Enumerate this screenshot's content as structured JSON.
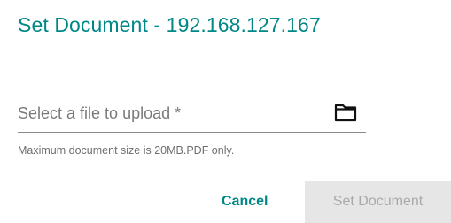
{
  "dialog": {
    "title": "Set Document - 192.168.127.167",
    "file_field": {
      "placeholder": "Select a file to upload *",
      "icon": "folder-icon"
    },
    "hint": "Maximum document size is 20MB.PDF only.",
    "actions": {
      "cancel_label": "Cancel",
      "submit_label": "Set Document",
      "submit_disabled": true
    }
  },
  "colors": {
    "accent": "#008787",
    "disabled_bg": "#e6e6e6",
    "disabled_text": "#a9a9a9",
    "placeholder_text": "#7a7a7a"
  }
}
